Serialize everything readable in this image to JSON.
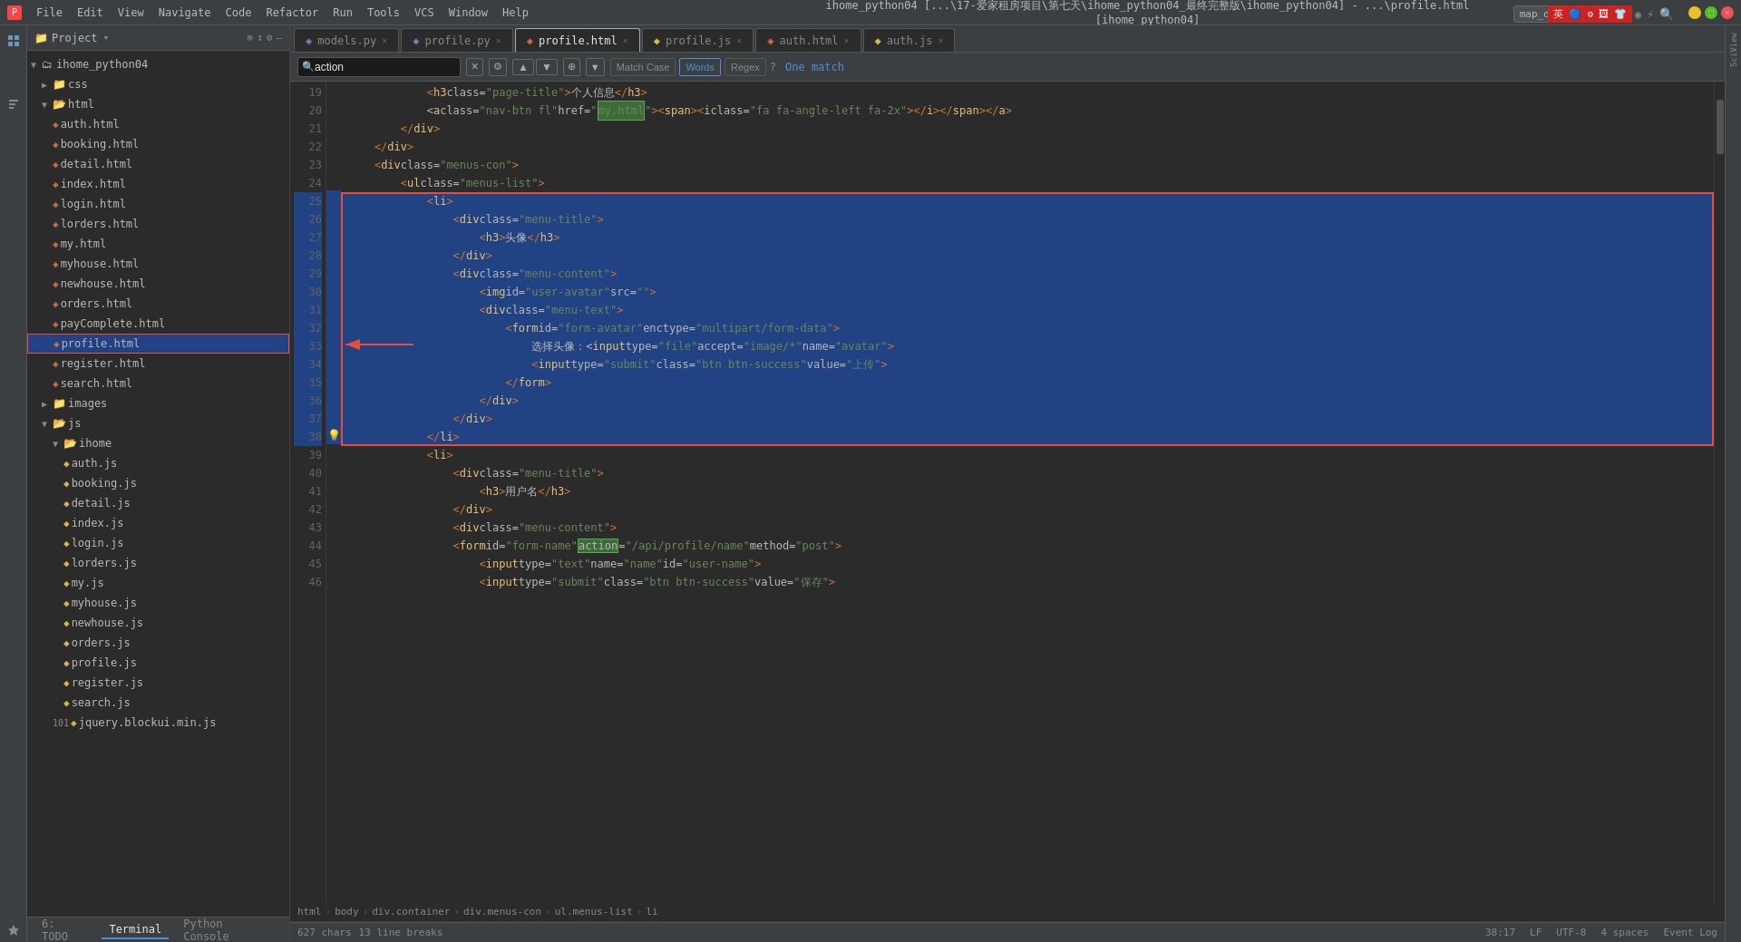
{
  "titleBar": {
    "appName": "ihome_python04",
    "titleText": "ihome_python04 [...\\17-爱家租房项目\\第七天\\ihome_python04_最终完整版\\ihome_python04] - ...\\profile.html [ihome_python04]",
    "menuItems": [
      "File",
      "Edit",
      "View",
      "Navigate",
      "Code",
      "Refactor",
      "Run",
      "Tools",
      "VCS",
      "Window",
      "Help"
    ]
  },
  "runConfig": {
    "label": "map_demo"
  },
  "projectPanel": {
    "title": "Project",
    "tree": [
      {
        "level": 1,
        "type": "folder",
        "name": "css",
        "expanded": false
      },
      {
        "level": 1,
        "type": "folder",
        "name": "html",
        "expanded": true
      },
      {
        "level": 2,
        "type": "file-html",
        "name": "auth.html"
      },
      {
        "level": 2,
        "type": "file-html",
        "name": "booking.html"
      },
      {
        "level": 2,
        "type": "file-html",
        "name": "detail.html"
      },
      {
        "level": 2,
        "type": "file-html",
        "name": "index.html"
      },
      {
        "level": 2,
        "type": "file-html",
        "name": "login.html"
      },
      {
        "level": 2,
        "type": "file-html",
        "name": "lorders.html"
      },
      {
        "level": 2,
        "type": "file-html",
        "name": "my.html"
      },
      {
        "level": 2,
        "type": "file-html",
        "name": "myhouse.html"
      },
      {
        "level": 2,
        "type": "file-html",
        "name": "newhouse.html"
      },
      {
        "level": 2,
        "type": "file-html",
        "name": "orders.html"
      },
      {
        "level": 2,
        "type": "file-html",
        "name": "payComplete.html"
      },
      {
        "level": 2,
        "type": "file-html",
        "name": "profile.html",
        "selected": true
      },
      {
        "level": 2,
        "type": "file-html",
        "name": "register.html"
      },
      {
        "level": 2,
        "type": "file-html",
        "name": "search.html"
      },
      {
        "level": 1,
        "type": "folder",
        "name": "images",
        "expanded": false
      },
      {
        "level": 1,
        "type": "folder",
        "name": "js",
        "expanded": true
      },
      {
        "level": 2,
        "type": "folder",
        "name": "ihome",
        "expanded": true
      },
      {
        "level": 3,
        "type": "file-js",
        "name": "auth.js"
      },
      {
        "level": 3,
        "type": "file-js",
        "name": "booking.js"
      },
      {
        "level": 3,
        "type": "file-js",
        "name": "detail.js"
      },
      {
        "level": 3,
        "type": "file-js",
        "name": "index.js"
      },
      {
        "level": 3,
        "type": "file-js",
        "name": "login.js"
      },
      {
        "level": 3,
        "type": "file-js",
        "name": "lorders.js"
      },
      {
        "level": 3,
        "type": "file-js",
        "name": "my.js"
      },
      {
        "level": 3,
        "type": "file-js",
        "name": "myhouse.js"
      },
      {
        "level": 3,
        "type": "file-js",
        "name": "newhouse.js"
      },
      {
        "level": 3,
        "type": "file-js",
        "name": "orders.js"
      },
      {
        "level": 3,
        "type": "file-js",
        "name": "profile.js"
      },
      {
        "level": 3,
        "type": "file-js",
        "name": "register.js"
      },
      {
        "level": 3,
        "type": "file-js",
        "name": "search.js"
      },
      {
        "level": 2,
        "type": "file-js",
        "name": "jquery.blockui.min.js"
      }
    ]
  },
  "tabs": [
    {
      "name": "models.py",
      "type": "py",
      "active": false,
      "modified": true
    },
    {
      "name": "profile.py",
      "type": "py",
      "active": false,
      "modified": true
    },
    {
      "name": "profile.html",
      "type": "html",
      "active": true,
      "modified": false
    },
    {
      "name": "profile.js",
      "type": "js",
      "active": false,
      "modified": false
    },
    {
      "name": "auth.html",
      "type": "html",
      "active": false,
      "modified": false
    },
    {
      "name": "auth.js",
      "type": "js",
      "active": false,
      "modified": false
    }
  ],
  "searchBar": {
    "query": "action",
    "matchCase": "Match Case",
    "words": "Words",
    "regex": "Regex",
    "matchCount": "One match"
  },
  "codeLines": [
    {
      "num": 19,
      "content": "            <h3 class=\"page-title\">个人信息</h3>",
      "selected": false
    },
    {
      "num": 20,
      "content": "            <a class=\"nav-btn fl\" href=\"/my.html\"><span><i class=\"fa fa-angle-left fa-2x\"></i></span></a>",
      "selected": false,
      "hasHighlight": true,
      "highlightText": "my.html",
      "highlightStart": 45,
      "highlightEnd": 52
    },
    {
      "num": 21,
      "content": "        </div>",
      "selected": false
    },
    {
      "num": 22,
      "content": "    </div>",
      "selected": false
    },
    {
      "num": 23,
      "content": "    <div class=\"menus-con\">",
      "selected": false
    },
    {
      "num": 24,
      "content": "        <ul class=\"menus-list\">",
      "selected": false
    },
    {
      "num": 25,
      "content": "            <li>",
      "selected": true
    },
    {
      "num": 26,
      "content": "                <div class=\"menu-title\">",
      "selected": true
    },
    {
      "num": 27,
      "content": "                    <h3>头像</h3>",
      "selected": true
    },
    {
      "num": 28,
      "content": "                </div>",
      "selected": true
    },
    {
      "num": 29,
      "content": "                <div class=\"menu-content\">",
      "selected": true
    },
    {
      "num": 30,
      "content": "                    <img id=\"user-avatar\" src=\"\">",
      "selected": true
    },
    {
      "num": 31,
      "content": "                    <div class=\"menu-text\">",
      "selected": true
    },
    {
      "num": 32,
      "content": "                        <form id=\"form-avatar\" enctype=\"multipart/form-data\">",
      "selected": true
    },
    {
      "num": 33,
      "content": "                            选择头像：<input type=\"file\" accept=\"image/*\" name=\"avatar\">",
      "selected": true
    },
    {
      "num": 34,
      "content": "                            <input type=\"submit\" class=\"btn btn-success\" value=\"上传\">",
      "selected": true
    },
    {
      "num": 35,
      "content": "                        </form>",
      "selected": true
    },
    {
      "num": 36,
      "content": "                    </div>",
      "selected": true
    },
    {
      "num": 37,
      "content": "                </div>",
      "selected": true
    },
    {
      "num": 38,
      "content": "            </li>",
      "selected": true
    },
    {
      "num": 39,
      "content": "            <li>",
      "selected": false
    },
    {
      "num": 40,
      "content": "                <div class=\"menu-title\">",
      "selected": false
    },
    {
      "num": 41,
      "content": "                    <h3>用户名</h3>",
      "selected": false
    },
    {
      "num": 42,
      "content": "                </div>",
      "selected": false
    },
    {
      "num": 43,
      "content": "                <div class=\"menu-content\">",
      "selected": false
    },
    {
      "num": 44,
      "content": "                <form id=\"form-name\" action=\"/api/profile/name\" method=\"post\">",
      "selected": false,
      "hasHighlight": true,
      "highlightText": "action",
      "isCurrentMatch": true
    },
    {
      "num": 45,
      "content": "                    <input type=\"text\" name=\"name\" id=\"user-name\">",
      "selected": false
    },
    {
      "num": 46,
      "content": "                    <input type=\"submit\" class=\"btn btn-success\" value=\"保存\">",
      "selected": false
    }
  ],
  "breadcrumb": {
    "parts": [
      "html",
      "body",
      "div.container",
      "div.menus-con",
      "ul.menus-list",
      "li"
    ]
  },
  "statusBar": {
    "chars": "627 chars",
    "lineBreaks": "13 line breaks",
    "position": "38:17",
    "lineEnding": "LF",
    "encoding": "UTF-8",
    "indent": "4 spaces",
    "eventLog": "Event Log"
  },
  "bottomTabs": [
    {
      "name": "6: TODO",
      "active": false
    },
    {
      "name": "Terminal",
      "active": false
    },
    {
      "name": "Python Console",
      "active": false
    }
  ],
  "leftIcons": [
    {
      "name": "project-icon",
      "symbol": "📁",
      "label": "1:Project"
    },
    {
      "name": "structure-icon",
      "symbol": "⊞",
      "label": "2:Structure"
    },
    {
      "name": "favorites-icon",
      "symbol": "★",
      "label": "2:Favorites"
    }
  ],
  "colors": {
    "selected": "#214283",
    "redBorder": "#e74c3c",
    "currentMatch": "#3d6b3a",
    "matchHighlight": "#214283"
  }
}
